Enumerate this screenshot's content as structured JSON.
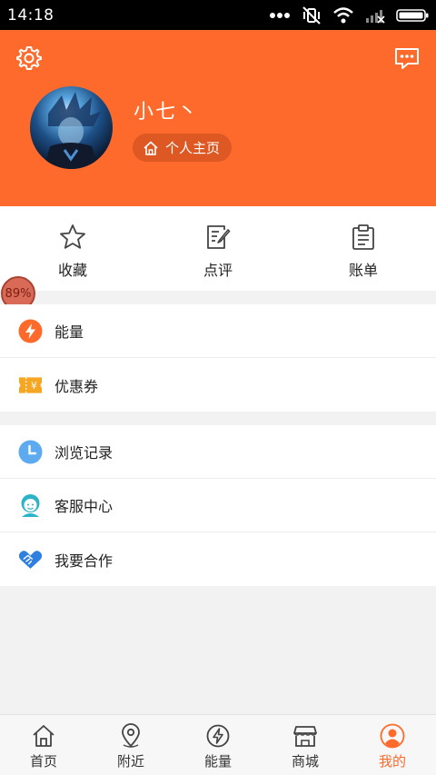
{
  "status_bar": {
    "time": "14:18"
  },
  "profile": {
    "username": "小七丶",
    "homepage_label": "个人主页"
  },
  "quick_actions": [
    {
      "label": "收藏",
      "icon": "star-icon"
    },
    {
      "label": "点评",
      "icon": "review-edit-icon"
    },
    {
      "label": "账单",
      "icon": "clipboard-bill-icon"
    }
  ],
  "overlay_badge": "89%",
  "menu_group_1": [
    {
      "label": "能量",
      "icon": "energy-bolt-icon"
    },
    {
      "label": "优惠券",
      "icon": "coupon-icon"
    }
  ],
  "menu_group_2": [
    {
      "label": "浏览记录",
      "icon": "history-clock-icon"
    },
    {
      "label": "客服中心",
      "icon": "customer-service-icon"
    },
    {
      "label": "我要合作",
      "icon": "handshake-icon"
    }
  ],
  "bottom_nav": [
    {
      "label": "首页",
      "icon": "home-icon"
    },
    {
      "label": "附近",
      "icon": "location-pin-icon"
    },
    {
      "label": "能量",
      "icon": "energy-icon"
    },
    {
      "label": "商城",
      "icon": "store-icon"
    },
    {
      "label": "我的",
      "icon": "user-icon",
      "active": true
    }
  ],
  "colors": {
    "accent": "#fe6a2c",
    "nav_active": "#fe6a2c"
  }
}
